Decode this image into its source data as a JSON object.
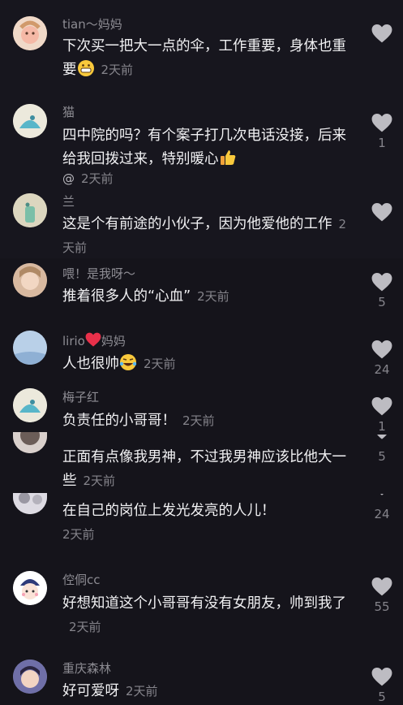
{
  "comments": [
    {
      "user": "tian～妈妈",
      "text": "下次买一把大一点的伞，工作重要，身体也重要",
      "time": "2天前",
      "likes": ""
    },
    {
      "user": "猫",
      "text": "四中院的吗？有个案子打几次电话没接，后来给我回拨过来，特别暖心",
      "prefix": "@",
      "time": "2天前",
      "likes": "1"
    },
    {
      "user": "兰",
      "text": "这是个有前途的小伙子，因为他爱他的工作",
      "time": "2天前",
      "likes": ""
    },
    {
      "user": "喂！是我呀～",
      "text": "推着很多人的“心血”",
      "time": "2天前",
      "likes": "5"
    },
    {
      "user_a": "lirio",
      "user_b": "妈妈",
      "text": "人也很帅",
      "time": "2天前",
      "likes": "24"
    },
    {
      "user": "梅子红",
      "text": "负责任的小哥哥！",
      "time": "2天前",
      "likes": "1"
    },
    {
      "text": "正面有点像我男神，不过我男神应该比他大一些",
      "time": "2天前",
      "likes": "5"
    },
    {
      "text": "在自己的岗位上发光发亮的人儿！",
      "time": "2天前",
      "likes": "24"
    },
    {
      "user": "倥侗cc",
      "text": "好想知道这个小哥哥有没有女朋友，帅到我了",
      "time": "2天前",
      "likes": "55"
    },
    {
      "user": "重庆森林",
      "text": "好可爱呀",
      "time": "2天前",
      "likes": "5"
    }
  ],
  "icons": {
    "like": "heart-icon",
    "emoji_grin": "grinning-emoji-icon",
    "emoji_laugh": "laughing-tears-emoji-icon",
    "emoji_thumb": "thumbs-up-emoji-icon",
    "red_heart": "red-heart-icon"
  },
  "colors": {
    "background": "#16151d",
    "text": "#f1f1f3",
    "muted": "#8d8c93",
    "heart": "#bdbcc2"
  }
}
